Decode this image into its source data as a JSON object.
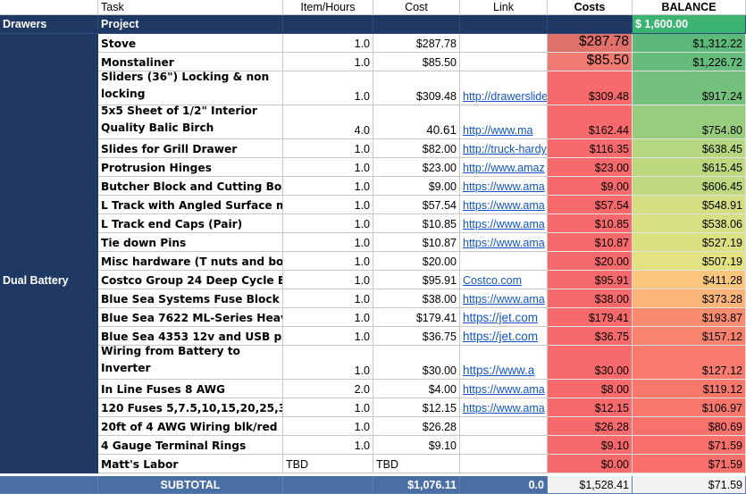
{
  "headers": {
    "task": "Task",
    "items": "Item/Hours",
    "cost": "Cost",
    "link": "Link",
    "costs": "Costs",
    "balance": "BALANCE"
  },
  "project": {
    "section": "Drawers",
    "label": "Project",
    "balance": "$ 1,600.00"
  },
  "rows": [
    {
      "section": "",
      "task": "Stove",
      "items": "1.0",
      "cost": "$287.78",
      "link": "",
      "costs": "$287.78",
      "balance": "$1,312.22",
      "cost_color": "#e0706a",
      "bal_color": "#5cb97a",
      "h": 21,
      "big": true
    },
    {
      "section": "",
      "task": "Monstaliner",
      "items": "1.0",
      "cost": "$85.50",
      "link": "",
      "costs": "$85.50",
      "balance": "$1,226.72",
      "cost_color": "#ef7b72",
      "bal_color": "#66bc7c",
      "h": 21,
      "big": true
    },
    {
      "section": "",
      "task": "Sliders (36\") Locking & non locking",
      "items": "1.0",
      "cost": "$309.48",
      "link": "http://drawerslide",
      "costs": "$309.48",
      "balance": "$917.24",
      "cost_color": "#f8696b",
      "bal_color": "#73c17c",
      "h": 38,
      "wrap": true
    },
    {
      "section": "",
      "task": "5x5 Sheet of 1/2\" Interior Quality Balic Birch",
      "items": "4.0",
      "cost": "40.61",
      "link": "http://www.ma",
      "costs": "$162.44",
      "balance": "$754.80",
      "cost_color": "#f8696b",
      "bal_color": "#98cd7e",
      "h": 38,
      "wrap": true,
      "bigcost": true
    },
    {
      "section": "",
      "task": "Slides for Grill Drawer",
      "items": "1.0",
      "cost": "$82.00",
      "link": "http://truck-hardy",
      "costs": "$116.35",
      "balance": "$638.45",
      "cost_color": "#f8696b",
      "bal_color": "#b6d67f",
      "h": 21
    },
    {
      "section": "",
      "task": "Protrusion Hinges",
      "items": "1.0",
      "cost": "$23.00",
      "link": "http://www.amaz",
      "costs": "$23.00",
      "balance": "$615.45",
      "cost_color": "#f8696b",
      "bal_color": "#bcd87f",
      "h": 21
    },
    {
      "section": "",
      "task": " Butcher Block and Cutting Board",
      "items": "1.0",
      "cost": "$9.00",
      "link": "https://www.ama",
      "costs": "$9.00",
      "balance": "$606.45",
      "cost_color": "#f8696b",
      "bal_color": "#c0d980",
      "h": 21
    },
    {
      "section": "",
      "task": "L Track with Angled Surface mount",
      "items": "1.0",
      "cost": "$57.54",
      "link": "https://www.ama",
      "costs": "$57.54",
      "balance": "$548.91",
      "cost_color": "#f8696b",
      "bal_color": "#d3de81",
      "h": 21
    },
    {
      "section": "",
      "task": "L Track end Caps (Pair)",
      "items": "1.0",
      "cost": "$10.85",
      "link": "https://www.ama",
      "costs": "$10.85",
      "balance": "$538.06",
      "cost_color": "#f8696b",
      "bal_color": "#d6df81",
      "h": 21
    },
    {
      "section": "",
      "task": "Tie down Pins",
      "items": "1.0",
      "cost": "$10.87",
      "link": "https://www.ama",
      "costs": "$10.87",
      "balance": "$527.19",
      "cost_color": "#f8696b",
      "bal_color": "#dce081",
      "h": 21
    },
    {
      "section": "",
      "task": "Misc hardware (T nuts and bolts)",
      "items": "1.0",
      "cost": "$20.00",
      "link": "",
      "costs": "$20.00",
      "balance": "$507.19",
      "cost_color": "#f8696b",
      "bal_color": "#e2e282",
      "h": 21
    },
    {
      "section": "Dual Battery",
      "task": "Costco Group 24 Deep Cycle Battery",
      "items": "1.0",
      "cost": "$95.91",
      "link": "Costco.com",
      "costs": "$95.91",
      "balance": "$411.28",
      "cost_color": "#f8696b",
      "bal_color": "#fbc77c",
      "h": 21
    },
    {
      "section": "",
      "task": "Blue Sea Systems Fuse Block 12",
      "items": "1.0",
      "cost": "$38.00",
      "link": "https://www.ama",
      "costs": "$38.00",
      "balance": "$373.28",
      "cost_color": "#f8696b",
      "bal_color": "#fbb578",
      "h": 21
    },
    {
      "section": "",
      "task": "Blue Sea 7622 ML-Series Heavy",
      "items": "1.0",
      "cost": "$179.41",
      "link": "https://jet.com",
      "costs": "$179.41",
      "balance": "$193.87",
      "cost_color": "#f8696b",
      "bal_color": "#f98b6f",
      "h": 21,
      "biglink": true
    },
    {
      "section": "",
      "task": "Blue Sea 4353 12v and USB panel",
      "items": "1.0",
      "cost": "$36.75",
      "link": "https://jet.com",
      "costs": "$36.75",
      "balance": "$157.12",
      "cost_color": "#f8696b",
      "bal_color": "#f8826e",
      "h": 21,
      "biglink": true
    },
    {
      "section": "",
      "task": "Wiring from Battery to Inverter",
      "items": "1.0",
      "cost": "$30.00",
      "link": "https://www.a",
      "costs": "$30.00",
      "balance": "$127.12",
      "cost_color": "#f8696b",
      "bal_color": "#f87b6d",
      "h": 38,
      "wrap": true,
      "biglink": true
    },
    {
      "section": "",
      "task": "In Line Fuses 8 AWG",
      "items": "2.0",
      "cost": "$4.00",
      "link": "https://www.ama",
      "costs": "$8.00",
      "balance": "$119.12",
      "cost_color": "#f8696b",
      "bal_color": "#f8796c",
      "h": 21
    },
    {
      "section": "",
      "task": "120 Fuses 5,7.5,10,15,20,25,30",
      "items": "1.0",
      "cost": "$12.15",
      "link": "https://www.ama",
      "costs": "$12.15",
      "balance": "$106.97",
      "cost_color": "#f8696b",
      "bal_color": "#f8776c",
      "h": 21
    },
    {
      "section": "",
      "task": "20ft of 4 AWG Wiring blk/red",
      "items": "1.0",
      "cost": "$26.28",
      "link": "",
      "costs": "$26.28",
      "balance": "$80.69",
      "cost_color": "#f8696b",
      "bal_color": "#f8716b",
      "h": 21
    },
    {
      "section": "",
      "task": "4 Gauge Terminal Rings",
      "items": "1.0",
      "cost": "$9.10",
      "link": "",
      "costs": "$9.10",
      "balance": "$71.59",
      "cost_color": "#f8696b",
      "bal_color": "#f86f6b",
      "h": 21
    },
    {
      "section": "",
      "task": "Matt's Labor",
      "items": "TBD",
      "cost": "TBD",
      "link": "",
      "costs": "$0.00",
      "balance": "$71.59",
      "cost_color": "#f8696b",
      "bal_color": "#f86f6b",
      "h": 21,
      "tbd": true
    }
  ],
  "subtotal": {
    "label": "SUBTOTAL",
    "cost": "$1,076.11",
    "link": "0.0",
    "costs": "$1,528.41",
    "balance": "$71.59"
  }
}
